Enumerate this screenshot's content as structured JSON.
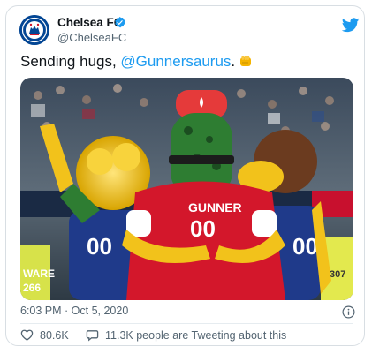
{
  "tweet": {
    "author": {
      "display_name": "Chelsea FC",
      "handle": "@ChelseaFC",
      "verified_icon": "verified-badge-icon",
      "avatar_icon": "chelsea-crest-avatar"
    },
    "text_prefix": "Sending hugs, ",
    "mention": "@Gunnersaurus",
    "text_suffix": ".",
    "emoji_icon": "oncoming-fist-emoji",
    "image": {
      "description_icon": "mascots-group-hug-photo",
      "back_print_name": "GUNNER",
      "back_print_number": "00",
      "left_mascot_number": "00",
      "right_mascot_number": "00",
      "banner_text_left": "WARE",
      "banner_text_left_2": "266",
      "banner_text_right": "307"
    },
    "timestamp": "6:03 PM · Oct 5, 2020",
    "likes_count": "80.6K",
    "conversation_text": "11.3K people are Tweeting about this"
  },
  "colors": {
    "mention_blue": "#1d9bf0",
    "twitter_blue": "#1d9bf0",
    "chelsea_blue": "#034694",
    "arsenal_red": "#d3172b",
    "secondary_text": "#536471"
  }
}
